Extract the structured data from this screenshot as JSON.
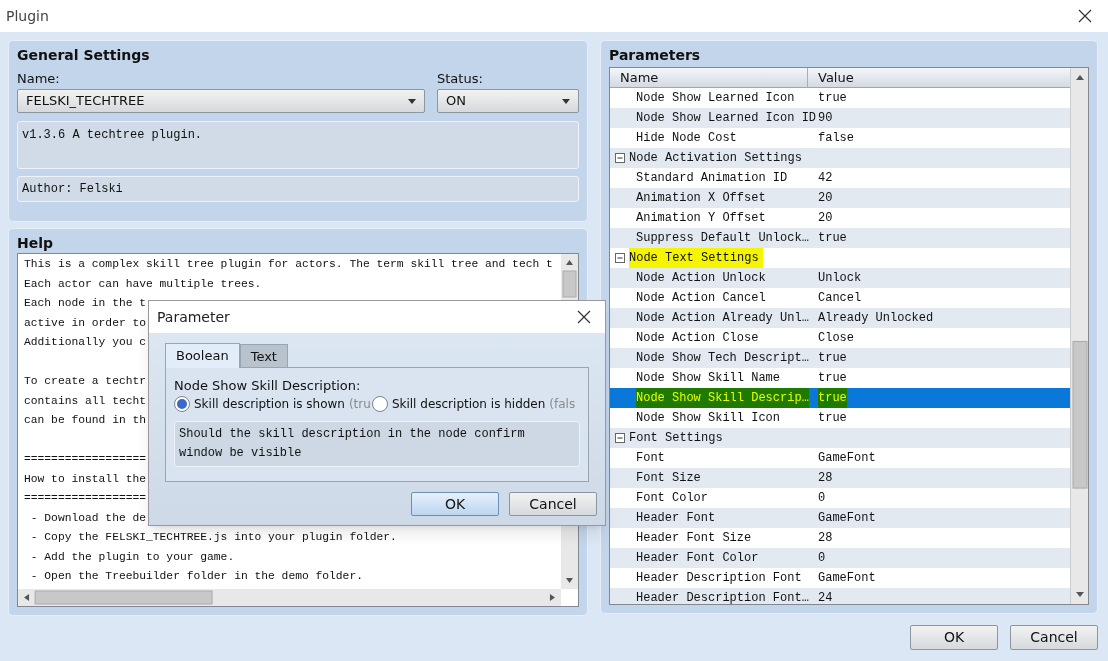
{
  "window": {
    "title": "Plugin"
  },
  "general": {
    "title": "General Settings",
    "name_label": "Name:",
    "name_value": "FELSKI_TECHTREE",
    "status_label": "Status:",
    "status_value": "ON",
    "description": "v1.3.6 A techtree plugin.",
    "author": "Author: Felski"
  },
  "help": {
    "title": "Help",
    "paragraphs": [
      [
        "This is a complex skill tree plugin for actors. The term skill tree and tech t",
        "Each actor can have multiple trees.",
        "Each node in the t",
        "active in order to",
        "Additionally you c"
      ],
      [
        "To create a techtr",
        "contains all techt",
        "can be found in th"
      ],
      [
        "==================",
        "How to install the",
        "==================",
        " - Download the de",
        " - Copy the FELSKI_TECHTREE.js into your plugin folder.",
        " - Add the plugin to your game.",
        " - Open the Treebuilder folder in the demo folder."
      ]
    ]
  },
  "parameters": {
    "title": "Parameters",
    "columns": [
      "Name",
      "Value"
    ],
    "rows": [
      {
        "kind": "item",
        "name": "Node Show Learned Icon",
        "value": "true",
        "selected": false,
        "highlighted": false
      },
      {
        "kind": "item",
        "name": "Node Show Learned Icon ID",
        "value": "90",
        "selected": false,
        "highlighted": false
      },
      {
        "kind": "item",
        "name": "Hide Node Cost",
        "value": "false",
        "selected": false,
        "highlighted": false
      },
      {
        "kind": "group",
        "name": "Node Activation Settings",
        "expanded": true,
        "selected": false,
        "highlighted": false
      },
      {
        "kind": "item",
        "name": "Standard Animation ID",
        "value": "42",
        "selected": false,
        "highlighted": false
      },
      {
        "kind": "item",
        "name": "Animation X Offset",
        "value": "20",
        "selected": false,
        "highlighted": false
      },
      {
        "kind": "item",
        "name": "Animation Y Offset",
        "value": "20",
        "selected": false,
        "highlighted": false
      },
      {
        "kind": "item",
        "name": "Suppress Default Unlock…",
        "value": "true",
        "selected": false,
        "highlighted": false
      },
      {
        "kind": "group",
        "name": "Node Text Settings",
        "expanded": true,
        "selected": false,
        "highlighted": true
      },
      {
        "kind": "item",
        "name": "Node Action Unlock",
        "value": "Unlock",
        "selected": false,
        "highlighted": false
      },
      {
        "kind": "item",
        "name": "Node Action Cancel",
        "value": "Cancel",
        "selected": false,
        "highlighted": false
      },
      {
        "kind": "item",
        "name": "Node Action Already Unl…",
        "value": "Already Unlocked",
        "selected": false,
        "highlighted": false
      },
      {
        "kind": "item",
        "name": "Node Action Close",
        "value": "Close",
        "selected": false,
        "highlighted": false
      },
      {
        "kind": "item",
        "name": "Node Show Tech Descript…",
        "value": "true",
        "selected": false,
        "highlighted": false
      },
      {
        "kind": "item",
        "name": "Node Show Skill Name",
        "value": "true",
        "selected": false,
        "highlighted": false
      },
      {
        "kind": "item",
        "name": "Node Show Skill Descrip…",
        "value": "true",
        "selected": true,
        "highlighted": true
      },
      {
        "kind": "item",
        "name": "Node Show Skill Icon",
        "value": "true",
        "selected": false,
        "highlighted": false
      },
      {
        "kind": "group",
        "name": "Font Settings",
        "expanded": true,
        "selected": false,
        "highlighted": false
      },
      {
        "kind": "item",
        "name": "Font",
        "value": "GameFont",
        "selected": false,
        "highlighted": false
      },
      {
        "kind": "item",
        "name": "Font Size",
        "value": "28",
        "selected": false,
        "highlighted": false
      },
      {
        "kind": "item",
        "name": "Font Color",
        "value": "0",
        "selected": false,
        "highlighted": false
      },
      {
        "kind": "item",
        "name": "Header Font",
        "value": "GameFont",
        "selected": false,
        "highlighted": false
      },
      {
        "kind": "item",
        "name": "Header Font Size",
        "value": "28",
        "selected": false,
        "highlighted": false
      },
      {
        "kind": "item",
        "name": "Header Font Color",
        "value": "0",
        "selected": false,
        "highlighted": false
      },
      {
        "kind": "item",
        "name": "Header Description Font",
        "value": "GameFont",
        "selected": false,
        "highlighted": false
      },
      {
        "kind": "item",
        "name": "Header Description Font…",
        "value": "24",
        "selected": false,
        "highlighted": false
      }
    ]
  },
  "buttons": [
    "OK",
    "Cancel"
  ],
  "dialog": {
    "title": "Parameter",
    "tabs": [
      {
        "label": "Boolean",
        "selected": true
      },
      {
        "label": "Text",
        "selected": false
      }
    ],
    "field_label": "Node Show Skill Description:",
    "options": [
      {
        "label": "Skill description is shown",
        "hint": "(tru",
        "selected": true
      },
      {
        "label": "Skill description is hidden",
        "hint": "(fals",
        "selected": false
      }
    ],
    "description": "Should the skill description in the node confirm window be visible",
    "buttons": [
      "OK",
      "Cancel"
    ]
  }
}
